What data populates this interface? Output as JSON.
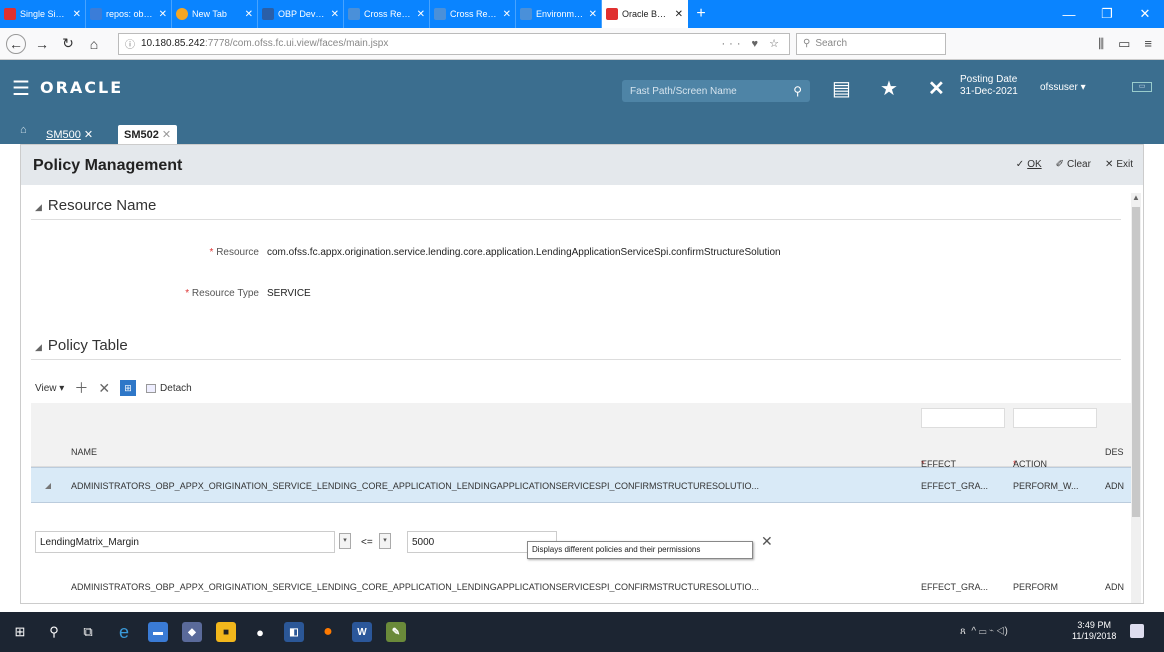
{
  "browser": {
    "tabs": [
      {
        "label": "Single Sign On",
        "color": "#e03030"
      },
      {
        "label": "repos: obpsh/...",
        "color": "#3b7dd8"
      },
      {
        "label": "New Tab",
        "color": "#f5a623"
      },
      {
        "label": "OBP DevOps - Your",
        "color": "#2a5fa8"
      },
      {
        "label": "Cross Reference",
        "color": "#4a90d9"
      },
      {
        "label": "Cross Reference",
        "color": "#4a90d9"
      },
      {
        "label": "Environment",
        "color": "#4a90d9"
      },
      {
        "label": "Oracle Banking",
        "color": "#e03030",
        "active": true
      }
    ],
    "url_host": "10.180.85.242",
    "url_rest": ":7778/com.ofss.fc.ui.view/faces/main.jspx",
    "search_placeholder": "Search"
  },
  "header": {
    "logo": "ORACLE",
    "fastpath_placeholder": "Fast Path/Screen Name",
    "posting_label": "Posting Date",
    "posting_date": "31-Dec-2021",
    "user": "ofssuser"
  },
  "app_tabs": {
    "inactive": "SM500",
    "active": "SM502"
  },
  "page": {
    "title": "Policy Management",
    "ok": "OK",
    "clear": "Clear",
    "exit": "Exit"
  },
  "resource_section": {
    "heading": "Resource Name",
    "resource_label": "Resource",
    "resource_value": "com.ofss.fc.appx.origination.service.lending.core.application.LendingApplicationServiceSpi.confirmStructureSolution",
    "type_label": "Resource Type",
    "type_value": "SERVICE"
  },
  "policy_section": {
    "heading": "Policy Table",
    "view_label": "View",
    "detach_label": "Detach",
    "columns": {
      "name": "NAME",
      "effect": "EFFECT",
      "action": "ACTION",
      "desc": "DES"
    },
    "rows": [
      {
        "name": "ADMINISTRATORS_OBP_APPX_ORIGINATION_SERVICE_LENDING_CORE_APPLICATION_LENDINGAPPLICATIONSERVICESPI_CONFIRMSTRUCTURESOLUTIO...",
        "effect": "EFFECT_GRA...",
        "action": "PERFORM_W...",
        "desc": "ADN"
      },
      {
        "name": "ADMINISTRATORS_OBP_APPX_ORIGINATION_SERVICE_LENDING_CORE_APPLICATION_LENDINGAPPLICATIONSERVICESPI_CONFIRMSTRUCTURESOLUTIO...",
        "effect": "EFFECT_GRA...",
        "action": "PERFORM",
        "desc": "ADN"
      }
    ],
    "condition": {
      "attribute": "LendingMatrix_Margin",
      "operator": "<=",
      "value": "5000",
      "tooltip": "Displays different policies and their permissions"
    }
  },
  "taskbar": {
    "time": "3:49 PM",
    "date": "11/19/2018"
  }
}
